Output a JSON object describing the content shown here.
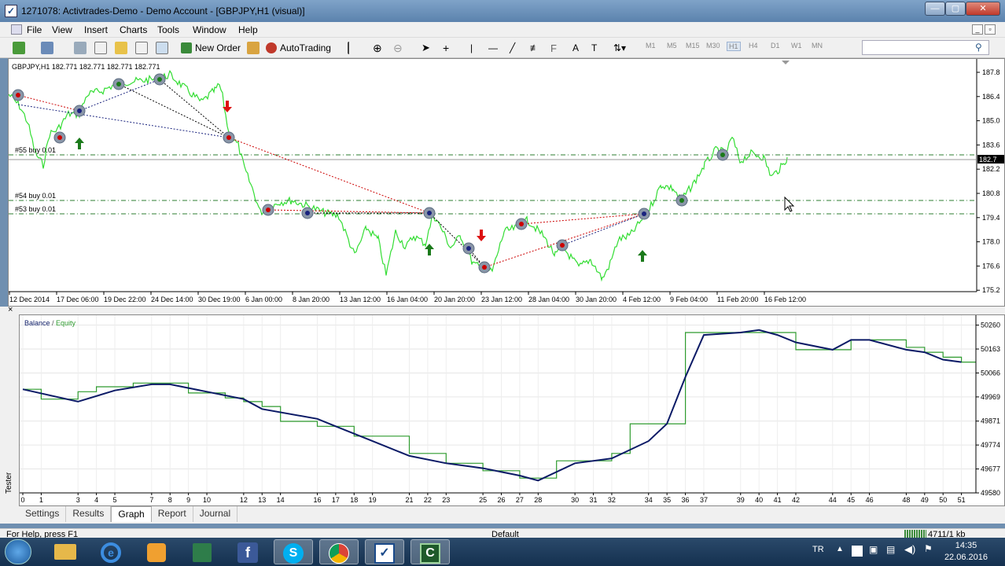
{
  "window": {
    "title": "1271078: Activtrades-Demo - Demo Account - [GBPJPY,H1 (visual)]"
  },
  "menu": [
    "File",
    "View",
    "Insert",
    "Charts",
    "Tools",
    "Window",
    "Help"
  ],
  "toolbar": {
    "new_order": "New Order",
    "autotrading": "AutoTrading",
    "timeframes": [
      "M1",
      "M5",
      "M15",
      "M30",
      "H1",
      "H4",
      "D1",
      "W1",
      "MN"
    ],
    "active_timeframe": "H1",
    "text_tool": "A",
    "text_label_tool": "T"
  },
  "price_chart": {
    "symbol_info": "GBPJPY,H1  182.771 182.771 182.771 182.771",
    "current_price": "182.7",
    "price_levels": [
      "187.8",
      "186.4",
      "185.0",
      "183.6",
      "182.2",
      "180.8",
      "179.4",
      "178.0",
      "176.6",
      "175.2"
    ],
    "time_labels": [
      "12 Dec 2014",
      "17 Dec 06:00",
      "19 Dec 22:00",
      "24 Dec 14:00",
      "30 Dec 19:00",
      "6 Jan 00:00",
      "8 Jan 20:00",
      "13 Jan 12:00",
      "16 Jan 04:00",
      "20 Jan 20:00",
      "23 Jan 12:00",
      "28 Jan 04:00",
      "30 Jan 20:00",
      "4 Feb 12:00",
      "9 Feb 04:00",
      "11 Feb 20:00",
      "16 Feb 12:00"
    ],
    "order_labels": [
      "#55 buy 0.01",
      "#54 buy 0.01",
      "#53 buy 0.01"
    ]
  },
  "equity_chart": {
    "legend_balance": "Balance",
    "legend_sep": " / ",
    "legend_equity": "Equity",
    "y_labels": [
      "50260",
      "50163",
      "50066",
      "49969",
      "49871",
      "49774",
      "49677",
      "49580"
    ],
    "x_labels": [
      "0",
      "1",
      "3",
      "4",
      "5",
      "7",
      "8",
      "9",
      "10",
      "12",
      "13",
      "14",
      "16",
      "17",
      "18",
      "19",
      "21",
      "22",
      "23",
      "25",
      "26",
      "27",
      "28",
      "30",
      "31",
      "32",
      "34",
      "35",
      "36",
      "37",
      "39",
      "40",
      "41",
      "42",
      "44",
      "45",
      "46",
      "48",
      "49",
      "50",
      "51"
    ]
  },
  "chart_data": {
    "type": "line",
    "title": "",
    "xlabel": "",
    "ylabel": "",
    "ylim": [
      49580,
      50300
    ],
    "series": [
      {
        "name": "Balance",
        "color": "#0b1a66",
        "x": [
          0,
          3,
          5,
          7,
          8,
          12,
          13,
          16,
          17,
          19,
          21,
          23,
          25,
          27,
          28,
          30,
          32,
          34,
          35,
          36,
          37,
          39,
          40,
          41,
          42,
          44,
          45,
          46,
          48,
          49,
          50,
          51
        ],
        "values": [
          50000,
          49950,
          49995,
          50020,
          50020,
          49960,
          49920,
          49880,
          49850,
          49790,
          49730,
          49700,
          49680,
          49650,
          49630,
          49700,
          49720,
          49790,
          49860,
          50050,
          50220,
          50230,
          50240,
          50220,
          50190,
          50160,
          50200,
          50200,
          50160,
          50150,
          50120,
          50110
        ]
      },
      {
        "name": "Equity",
        "color": "#2e9b2e",
        "x": [
          0,
          1,
          2,
          3,
          4,
          5,
          6,
          7,
          8,
          9,
          10,
          11,
          12,
          13,
          14,
          15,
          16,
          17,
          18,
          19,
          20,
          21,
          22,
          23,
          24,
          25,
          26,
          27,
          28,
          29,
          30,
          31,
          32,
          33,
          34,
          35,
          36,
          37,
          38,
          39,
          40,
          41,
          42,
          43,
          44,
          45,
          46,
          47,
          48,
          49,
          50,
          51
        ],
        "values": [
          50000,
          49960,
          49960,
          49990,
          50010,
          50010,
          50025,
          50025,
          50025,
          49985,
          49985,
          49965,
          49950,
          49930,
          49870,
          49870,
          49850,
          49850,
          49810,
          49810,
          49810,
          49740,
          49740,
          49700,
          49700,
          49670,
          49670,
          49640,
          49640,
          49710,
          49710,
          49710,
          49740,
          49860,
          49860,
          49860,
          50230,
          50230,
          50230,
          50230,
          50230,
          50230,
          50160,
          50160,
          50160,
          50200,
          50200,
          50200,
          50170,
          50150,
          50130,
          50110
        ]
      }
    ],
    "y_tick_labels": [
      "50260",
      "50163",
      "50066",
      "49969",
      "49871",
      "49774",
      "49677",
      "49580"
    ],
    "grid": true,
    "legend": "top-left"
  },
  "tester_tabs": [
    "Settings",
    "Results",
    "Graph",
    "Report",
    "Journal"
  ],
  "active_tab": "Graph",
  "vertical_tab": "Tester",
  "status": {
    "help": "For Help, press F1",
    "profile": "Default",
    "conn": "4711/1 kb"
  },
  "taskbar": {
    "lang": "TR",
    "time": "14:35",
    "date": "22.06.2016"
  }
}
